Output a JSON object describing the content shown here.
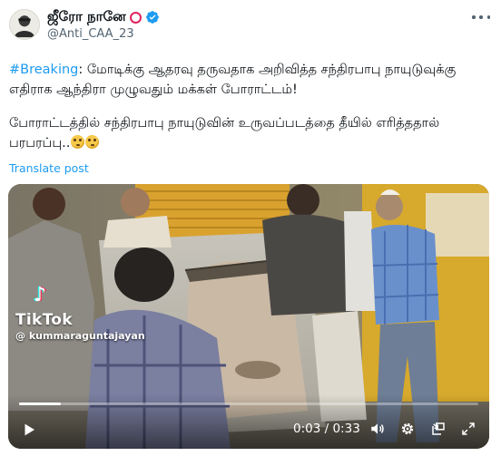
{
  "author": {
    "display_name": "ஜீரோ நானே",
    "handle": "@Anti_CAA_23",
    "avatar_icon": "avatar-icon",
    "verified_icon": "verified-badge-icon",
    "ring_icon": "red-ring-icon"
  },
  "menu": {
    "icon": "more-options-icon"
  },
  "tweet": {
    "hashtag": "#Breaking",
    "line1": ": மோடிக்கு ஆதரவு தருவதாக அறிவித்த சந்திரபாபு நாயுடுவுக்கு எதிராக ஆந்திரா முழுவதும் மக்கள் போராட்டம்!",
    "line2": "போராட்டத்தில் சந்திரபாபு நாயுடுவின் உருவப்படத்தை தீயில் எரித்ததால் பரபரப்பு..",
    "emoji": "flushed-face-emoji"
  },
  "translate_label": "Translate post",
  "video": {
    "watermark_app": "TikTok",
    "watermark_user": "@ kummaraguntajayan",
    "current_time": "0:03",
    "separator": " / ",
    "duration": "0:33",
    "progress": 0.09,
    "icons": [
      "play-icon",
      "volume-icon",
      "settings-gear-icon",
      "picture-in-picture-icon",
      "fullscreen-icon"
    ]
  },
  "colors": {
    "link": "#1d9bf0",
    "secondary_text": "#536471",
    "text": "#0f1419",
    "ring": "#e0245e"
  }
}
